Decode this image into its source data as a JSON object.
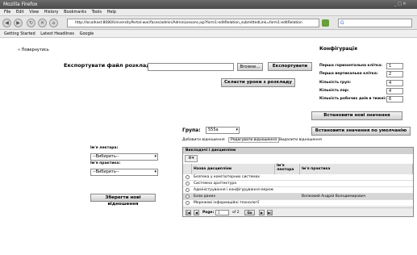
{
  "window": {
    "title": "Mozilla Firefox"
  },
  "menu": [
    "File",
    "Edit",
    "View",
    "History",
    "Bookmarks",
    "Tools",
    "Help"
  ],
  "address": {
    "url": "http://localhost:8080/UniversityPortal-war/faces/admin/AdminLessons.jsp?form1:editRelation_submittedLink=form1:editRelation"
  },
  "bookmarks": [
    "Getting Started",
    "Latest Headlines",
    "Google"
  ],
  "back_link": "« Повернутись",
  "export": {
    "label": "Експортувати файл розкладу:",
    "browse": "Browse...",
    "export_button": "Експортувати",
    "compose_button": "Скласти уроки з розкладу"
  },
  "config": {
    "title": "Конфігурація",
    "fields": [
      {
        "label": "Перша горизонтальна клітка:",
        "value": "1"
      },
      {
        "label": "Перша вертикальна клітка:",
        "value": "2"
      },
      {
        "label": "Кількість груп:",
        "value": "4"
      },
      {
        "label": "Кількість пар:",
        "value": "4"
      },
      {
        "label": "Кількість робочих днів в тижні:",
        "value": "6"
      }
    ],
    "set_button": "Встановити нові значення",
    "default_button": "Встановити значення по умолчанію"
  },
  "group": {
    "label": "Група:",
    "value": "555а",
    "tabs": [
      "Добавити відношення",
      "Редагувати відношення",
      "Видалити відношення"
    ]
  },
  "left_form": {
    "lecturer_label": "Ім'я лектора:",
    "lecturer_value": "--Вибирить--",
    "practice_label": "Ім'я практика:",
    "practice_value": "--Вибирить--",
    "save_button": "Зберегти нові відношення"
  },
  "table": {
    "caption": "Викладачі і дисципліни",
    "columns": [
      "Назва дисципліни",
      "Ім'я лектора",
      "Ім'я практика"
    ],
    "rows": [
      {
        "name": "Безпека у комп'ютерних системах",
        "lecturer": "",
        "practice": ""
      },
      {
        "name": "Системна архітектура",
        "lecturer": "",
        "practice": ""
      },
      {
        "name": "Адміністрування і конфігурування мереж",
        "lecturer": "",
        "practice": ""
      },
      {
        "name": "Бази даних",
        "lecturer": "",
        "practice": "Волковий Андрій Володимирович"
      },
      {
        "name": "Мережеві інформаційні технології",
        "lecturer": "",
        "practice": ""
      }
    ],
    "pager": {
      "page_label": "Page:",
      "page": "1",
      "of": "of 2",
      "go": "Go"
    }
  }
}
